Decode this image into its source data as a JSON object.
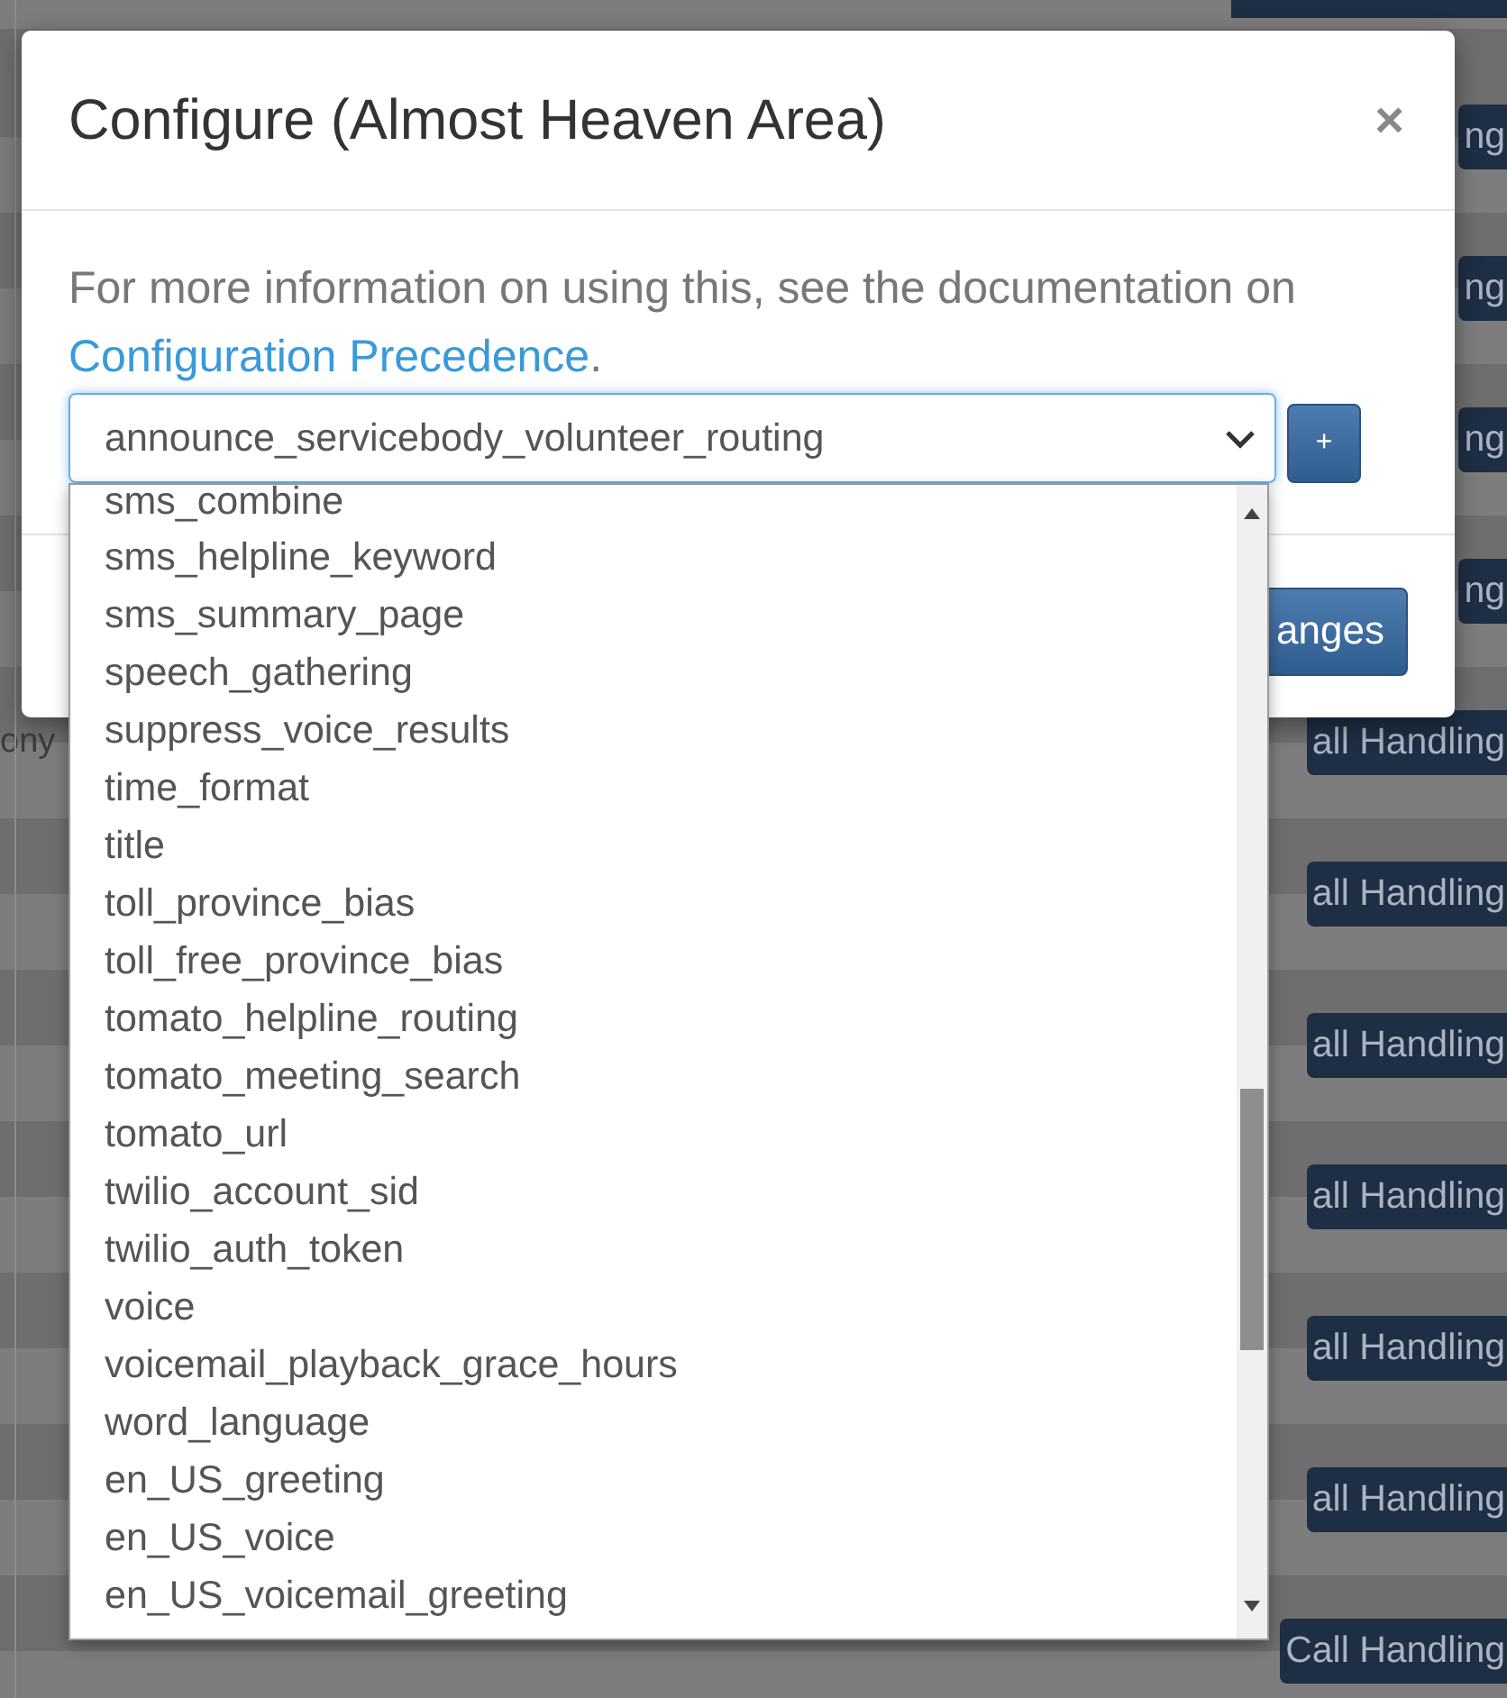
{
  "background": {
    "side_text": "ony",
    "rows": [
      {
        "button": "ng"
      },
      {
        "button": "ng"
      },
      {
        "button": "ng"
      },
      {
        "button": "ng"
      },
      {
        "button": "all Handling"
      },
      {
        "button": "all Handling"
      },
      {
        "button": "all Handling"
      },
      {
        "button": "all Handling"
      },
      {
        "button": "all Handling"
      },
      {
        "button": "all Handling"
      },
      {
        "button": "Call Handling"
      }
    ]
  },
  "modal": {
    "title": "Configure (Almost Heaven Area)",
    "close": "×",
    "intro": "For more information on using this, see the documentation on",
    "link": "Configuration Precedence",
    "intro_end": ".",
    "select": {
      "value": "announce_servicebody_volunteer_routing",
      "open": true
    },
    "add_button": "+",
    "footer_button": "anges"
  },
  "dropdown": {
    "items": [
      "sms_combine",
      "sms_helpline_keyword",
      "sms_summary_page",
      "speech_gathering",
      "suppress_voice_results",
      "time_format",
      "title",
      "toll_province_bias",
      "toll_free_province_bias",
      "tomato_helpline_routing",
      "tomato_meeting_search",
      "tomato_url",
      "twilio_account_sid",
      "twilio_auth_token",
      "voice",
      "voicemail_playback_grace_hours",
      "word_language",
      "en_US_greeting",
      "en_US_voice",
      "en_US_voicemail_greeting"
    ]
  }
}
